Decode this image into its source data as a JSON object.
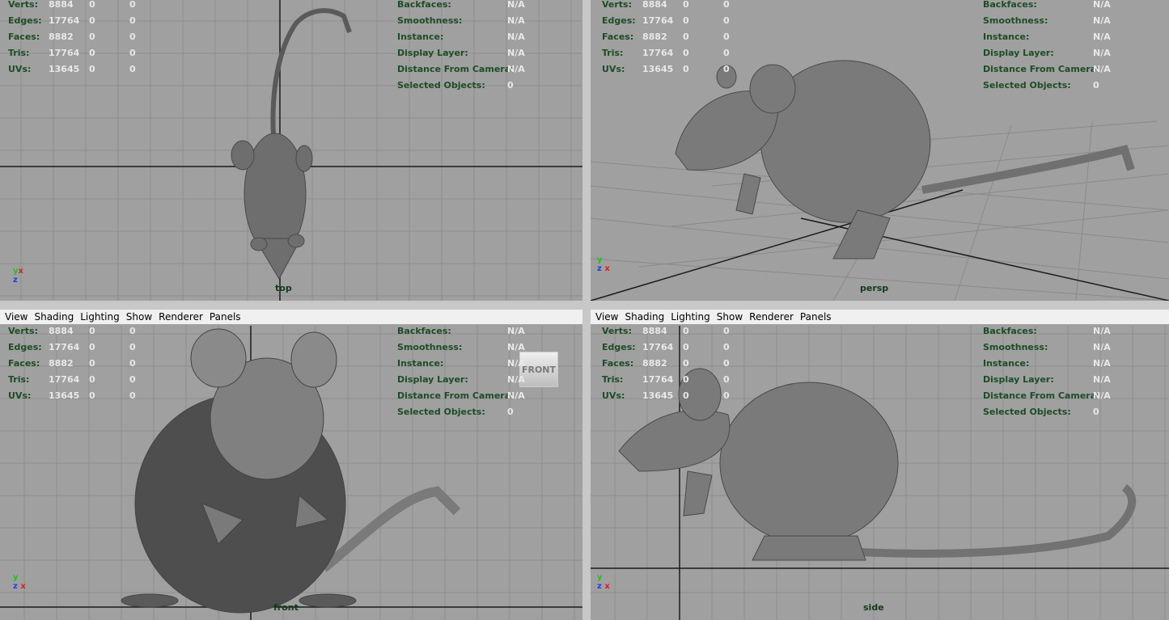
{
  "menu": [
    "View",
    "Shading",
    "Lighting",
    "Show",
    "Renderer",
    "Panels"
  ],
  "hud_left": [
    {
      "label": "Verts:",
      "v1": "8884",
      "v2": "0",
      "v3": "0"
    },
    {
      "label": "Edges:",
      "v1": "17764",
      "v2": "0",
      "v3": "0"
    },
    {
      "label": "Faces:",
      "v1": "8882",
      "v2": "0",
      "v3": "0"
    },
    {
      "label": "Tris:",
      "v1": "17764",
      "v2": "0",
      "v3": "0"
    },
    {
      "label": "UVs:",
      "v1": "13645",
      "v2": "0",
      "v3": "0"
    }
  ],
  "hud_right": [
    {
      "label": "Backfaces:",
      "value": "N/A"
    },
    {
      "label": "Smoothness:",
      "value": "N/A"
    },
    {
      "label": "Instance:",
      "value": "N/A"
    },
    {
      "label": "Display Layer:",
      "value": "N/A"
    },
    {
      "label": "Distance From Camera:",
      "value": "N/A"
    },
    {
      "label": "Selected Objects:",
      "value": "0"
    }
  ],
  "viewports": {
    "top": {
      "camera": "top",
      "axes": [
        "x",
        "z"
      ]
    },
    "persp": {
      "camera": "persp",
      "axes": [
        "y",
        "z",
        "x"
      ]
    },
    "front": {
      "camera": "front",
      "axes": [
        "y",
        "z",
        "x"
      ],
      "viewcube": "FRONT"
    },
    "side": {
      "camera": "side",
      "axes": [
        "y",
        "z",
        "x"
      ]
    }
  },
  "colors": {
    "viewport_bg": "#a0a0a0",
    "grid": "#8e8e8e",
    "axis_line": "#1a1a1a",
    "hud_label": "#1c4d26",
    "hud_value": "#e8e8e8",
    "axis_x": "#d82020",
    "axis_y": "#22c022",
    "axis_z": "#2040d8"
  }
}
